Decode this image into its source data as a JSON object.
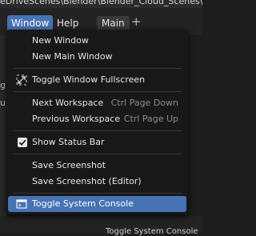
{
  "titlebar": {
    "text": "eDriveScenes\\Blender\\Blender_Cloud_Scenes\\ble"
  },
  "topbar": {
    "menus": [
      "Window",
      "Help"
    ],
    "tab": "Main",
    "add_tab": "+"
  },
  "left_fragments": [
    "g",
    "ur"
  ],
  "bottom": {
    "label": "Toggle System Console"
  },
  "window_menu": {
    "items": {
      "new_window": "New Window",
      "new_main_window": "New Main Window",
      "toggle_fullscreen": "Toggle Window Fullscreen",
      "next_workspace": "Next Workspace",
      "next_workspace_shortcut": "Ctrl Page Down",
      "previous_workspace": "Previous Workspace",
      "previous_workspace_shortcut": "Ctrl Page Up",
      "show_status_bar": "Show Status Bar",
      "save_screenshot": "Save Screenshot",
      "save_screenshot_editor": "Save Screenshot (Editor)",
      "toggle_system_console": "Toggle System Console"
    },
    "show_status_bar_checked": true,
    "icons": {
      "toggle_fullscreen": "fullscreen-icon",
      "show_status_bar": "checkbox-icon",
      "toggle_system_console": "console-icon"
    },
    "accent_color": "#4772b3"
  }
}
